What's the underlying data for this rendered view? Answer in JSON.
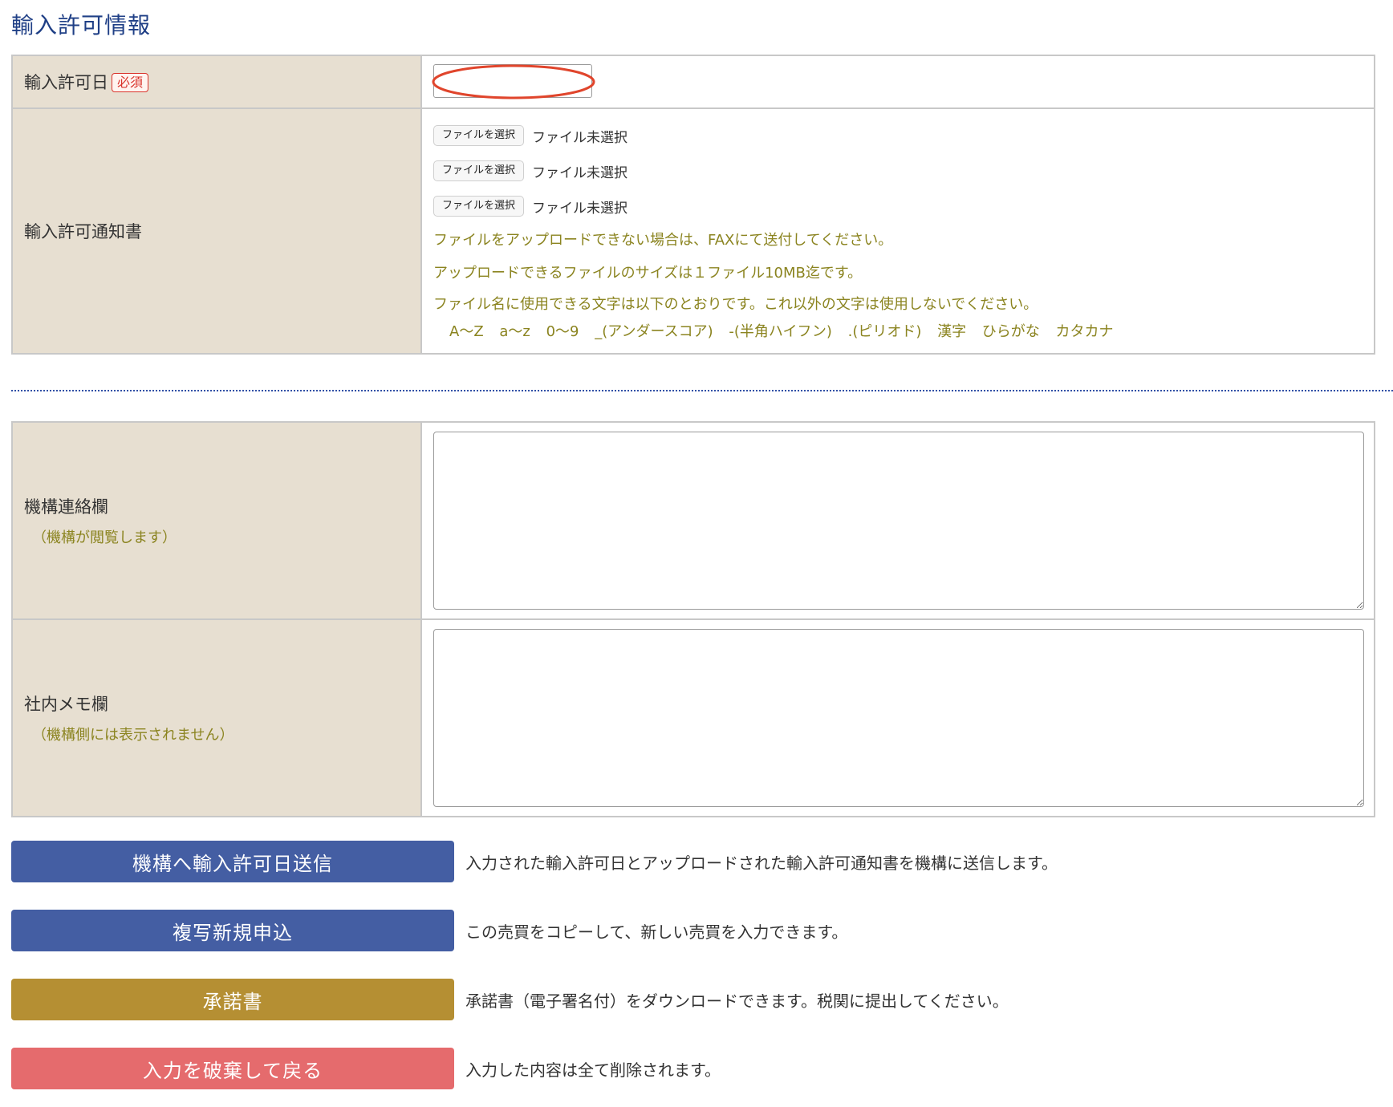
{
  "section": {
    "title": "輸入許可情報"
  },
  "permit_date": {
    "label": "輸入許可日",
    "required_badge": "必須",
    "value": ""
  },
  "permit_notice": {
    "label": "輸入許可通知書",
    "files": [
      {
        "button": "ファイルを選択",
        "status": "ファイル未選択"
      },
      {
        "button": "ファイルを選択",
        "status": "ファイル未選択"
      },
      {
        "button": "ファイルを選択",
        "status": "ファイル未選択"
      }
    ],
    "notes": [
      "ファイルをアップロードできない場合は、FAXにて送付してください。",
      "アップロードできるファイルのサイズは１ファイル10MB迄です。",
      "ファイル名に使用できる文字は以下のとおりです。これ以外の文字は使用しないでください。"
    ],
    "allowed_chars": "A〜Z a〜z 0〜9 _(アンダースコア) -(半角ハイフン) .(ピリオド) 漢字 ひらがな カタカナ"
  },
  "agency_memo": {
    "label": "機構連絡欄",
    "sublabel": "（機構が閲覧します）",
    "value": ""
  },
  "internal_memo": {
    "label": "社内メモ欄",
    "sublabel": "（機構側には表示されません）",
    "value": ""
  },
  "actions": [
    {
      "label": "機構へ輸入許可日送信",
      "description": "入力された輸入許可日とアップロードされた輸入許可通知書を機構に送信します。",
      "color": "#445ea3"
    },
    {
      "label": "複写新規申込",
      "description": "この売買をコピーして、新しい売買を入力できます。",
      "color": "#445ea3"
    },
    {
      "label": "承諾書",
      "description": "承諾書（電子署名付）をダウンロードできます。税関に提出してください。",
      "color": "#b58f33"
    },
    {
      "label": "入力を破棄して戻る",
      "description": "入力した内容は全て削除されます。",
      "color": "#e56b6d"
    }
  ],
  "annotation": {
    "color": "#e0452c"
  }
}
